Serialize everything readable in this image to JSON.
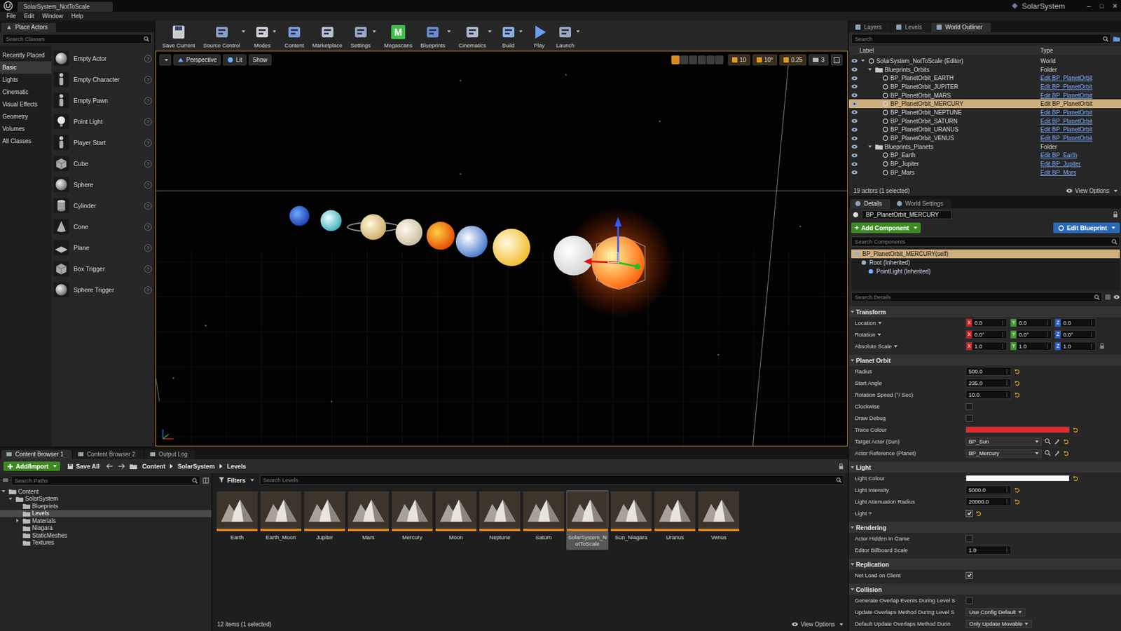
{
  "window": {
    "title": "SolarSystem_NotToScale",
    "project": "SolarSystem",
    "controls": [
      "–",
      "□",
      "✕"
    ]
  },
  "menu": [
    "File",
    "Edit",
    "Window",
    "Help"
  ],
  "place_actors": {
    "title": "Place Actors",
    "search_placeholder": "Search Classes",
    "help_glyph": "?",
    "categories": [
      {
        "label": "Recently Placed",
        "selected": false
      },
      {
        "label": "Basic",
        "selected": true
      },
      {
        "label": "Lights",
        "selected": false
      },
      {
        "label": "Cinematic",
        "selected": false
      },
      {
        "label": "Visual Effects",
        "selected": false
      },
      {
        "label": "Geometry",
        "selected": false
      },
      {
        "label": "Volumes",
        "selected": false
      },
      {
        "label": "All Classes",
        "selected": false
      }
    ],
    "items": [
      "Empty Actor",
      "Empty Character",
      "Empty Pawn",
      "Point Light",
      "Player Start",
      "Cube",
      "Sphere",
      "Cylinder",
      "Cone",
      "Plane",
      "Box Trigger",
      "Sphere Trigger"
    ]
  },
  "toolbar": [
    {
      "label": "Save Current",
      "dropdown": false
    },
    {
      "label": "Source Control",
      "dropdown": true
    },
    {
      "label": "Modes",
      "dropdown": true
    },
    {
      "label": "Content",
      "dropdown": false
    },
    {
      "label": "Marketplace",
      "dropdown": false
    },
    {
      "label": "Settings",
      "dropdown": true
    },
    {
      "label": "Megascans",
      "dropdown": false,
      "icon_text": "M"
    },
    {
      "label": "Blueprints",
      "dropdown": true
    },
    {
      "label": "Cinematics",
      "dropdown": true
    },
    {
      "label": "Build",
      "dropdown": true
    },
    {
      "label": "Play",
      "dropdown": false
    },
    {
      "label": "Launch",
      "dropdown": true
    }
  ],
  "viewport": {
    "view_mode": "Perspective",
    "lighting": "Lit",
    "show": "Show",
    "grid_snap": "10",
    "rotation_snap": "10°",
    "scale_snap": "0.25",
    "camera_speed": "3"
  },
  "content_browser": {
    "tabs": [
      {
        "label": "Content Browser 1",
        "selected": true
      },
      {
        "label": "Content Browser 2",
        "selected": false
      },
      {
        "label": "Output Log",
        "selected": false
      }
    ],
    "add_import": "Add/Import",
    "save_all": "Save All",
    "breadcrumb": [
      "Content",
      "SolarSystem",
      "Levels"
    ],
    "path_search": "Search Paths",
    "filters": "Filters",
    "search_placeholder": "Search Levels",
    "tree": [
      {
        "label": "Content",
        "depth": 0,
        "has_children": true,
        "expanded": true,
        "selected": false
      },
      {
        "label": "SolarSystem",
        "depth": 1,
        "has_children": true,
        "expanded": true,
        "selected": false
      },
      {
        "label": "Blueprints",
        "depth": 2,
        "has_children": false,
        "expanded": false,
        "selected": false
      },
      {
        "label": "Levels",
        "depth": 2,
        "has_children": false,
        "expanded": false,
        "selected": true
      },
      {
        "label": "Materials",
        "depth": 2,
        "has_children": true,
        "expanded": false,
        "selected": false
      },
      {
        "label": "Niagara",
        "depth": 2,
        "has_children": false,
        "expanded": false,
        "selected": false
      },
      {
        "label": "StaticMeshes",
        "depth": 2,
        "has_children": false,
        "expanded": false,
        "selected": false
      },
      {
        "label": "Textures",
        "depth": 2,
        "has_children": false,
        "expanded": false,
        "selected": false
      }
    ],
    "assets": [
      {
        "label": "Earth",
        "selected": false
      },
      {
        "label": "Earth_Moon",
        "selected": false
      },
      {
        "label": "Jupiter",
        "selected": false
      },
      {
        "label": "Mars",
        "selected": false
      },
      {
        "label": "Mercury",
        "selected": false
      },
      {
        "label": "Moon",
        "selected": false
      },
      {
        "label": "Neptune",
        "selected": false
      },
      {
        "label": "Saturn",
        "selected": false
      },
      {
        "label": "SolarSystem_NotToScale",
        "selected": true
      },
      {
        "label": "Sun_Niagara",
        "selected": false
      },
      {
        "label": "Uranus",
        "selected": false
      },
      {
        "label": "Venus",
        "selected": false
      }
    ],
    "status": "12 items (1 selected)",
    "view_options": "View Options"
  },
  "outliner": {
    "tabs": [
      {
        "label": "Layers",
        "selected": false
      },
      {
        "label": "Levels",
        "selected": false
      },
      {
        "label": "World Outliner",
        "selected": true
      }
    ],
    "search_placeholder": "Search",
    "columns": [
      "Label",
      "Type"
    ],
    "rows": [
      {
        "label": "SolarSystem_NotToScale (Editor)",
        "type": "World",
        "depth": 0,
        "kind": "world",
        "expanded": true,
        "selected": false
      },
      {
        "label": "Blueprints_Orbits",
        "type": "Folder",
        "depth": 1,
        "kind": "folder",
        "expanded": true,
        "selected": false
      },
      {
        "label": "BP_PlanetOrbit_EARTH",
        "type": "Edit BP_PlanetOrbit",
        "depth": 2,
        "kind": "actor",
        "expanded": false,
        "selected": false
      },
      {
        "label": "BP_PlanetOrbit_JUPITER",
        "type": "Edit BP_PlanetOrbit",
        "depth": 2,
        "kind": "actor",
        "expanded": false,
        "selected": false
      },
      {
        "label": "BP_PlanetOrbit_MARS",
        "type": "Edit BP_PlanetOrbit",
        "depth": 2,
        "kind": "actor",
        "expanded": false,
        "selected": false
      },
      {
        "label": "BP_PlanetOrbit_MERCURY",
        "type": "Edit BP_PlanetOrbit",
        "depth": 2,
        "kind": "actor",
        "expanded": false,
        "selected": true
      },
      {
        "label": "BP_PlanetOrbit_NEPTUNE",
        "type": "Edit BP_PlanetOrbit",
        "depth": 2,
        "kind": "actor",
        "expanded": false,
        "selected": false
      },
      {
        "label": "BP_PlanetOrbit_SATURN",
        "type": "Edit BP_PlanetOrbit",
        "depth": 2,
        "kind": "actor",
        "expanded": false,
        "selected": false
      },
      {
        "label": "BP_PlanetOrbit_URANUS",
        "type": "Edit BP_PlanetOrbit",
        "depth": 2,
        "kind": "actor",
        "expanded": false,
        "selected": false
      },
      {
        "label": "BP_PlanetOrbit_VENUS",
        "type": "Edit BP_PlanetOrbit",
        "depth": 2,
        "kind": "actor",
        "expanded": false,
        "selected": false
      },
      {
        "label": "Blueprints_Planets",
        "type": "Folder",
        "depth": 1,
        "kind": "folder",
        "expanded": true,
        "selected": false
      },
      {
        "label": "BP_Earth",
        "type": "Edit BP_Earth",
        "depth": 2,
        "kind": "actor",
        "expanded": false,
        "selected": false
      },
      {
        "label": "BP_Jupiter",
        "type": "Edit BP_Jupiter",
        "depth": 2,
        "kind": "actor",
        "expanded": false,
        "selected": false
      },
      {
        "label": "BP_Mars",
        "type": "Edit BP_Mars",
        "depth": 2,
        "kind": "actor",
        "expanded": false,
        "selected": false
      }
    ],
    "status": "19 actors (1 selected)",
    "view_options": "View Options"
  },
  "details": {
    "tabs": [
      {
        "label": "Details",
        "selected": true
      },
      {
        "label": "World Settings",
        "selected": false
      }
    ],
    "name": "BP_PlanetOrbit_MERCURY",
    "add_component": "Add Component",
    "add_glyph": "+",
    "edit_blueprint": "Edit Blueprint",
    "search_components": "Search Components",
    "components": [
      {
        "label": "BP_PlanetOrbit_MERCURY(self)",
        "depth": 0,
        "selected": true
      },
      {
        "label": "Root (Inherited)",
        "depth": 1,
        "selected": false
      },
      {
        "label": "PointLight (Inherited)",
        "depth": 2,
        "selected": false
      }
    ],
    "search_details": "Search Details",
    "axes": [
      "X",
      "Y",
      "Z"
    ],
    "sections": [
      {
        "title": "Transform",
        "expanded": true,
        "rows": [
          {
            "label": "Location",
            "kind": "vec3",
            "dropdown": true,
            "lock": false,
            "values": [
              "0.0",
              "0.0",
              "0.0"
            ],
            "modified": false
          },
          {
            "label": "Rotation",
            "kind": "vec3",
            "dropdown": true,
            "lock": false,
            "values": [
              "0.0°",
              "0.0°",
              "0.0°"
            ],
            "modified": false
          },
          {
            "label": "Absolute Scale",
            "kind": "vec3",
            "dropdown": true,
            "lock": true,
            "values": [
              "1.0",
              "1.0",
              "1.0"
            ],
            "modified": false
          }
        ]
      },
      {
        "title": "Planet Orbit",
        "expanded": true,
        "rows": [
          {
            "label": "Radius",
            "kind": "number",
            "value": "500.0",
            "modified": true
          },
          {
            "label": "Start Angle",
            "kind": "number",
            "value": "235.0",
            "modified": true
          },
          {
            "label": "Rotation Speed (°/ Sec)",
            "kind": "number",
            "value": "10.0",
            "modified": true
          },
          {
            "label": "Clockwise",
            "kind": "checkbox",
            "checked": false,
            "modified": false
          },
          {
            "label": "Draw Debug",
            "kind": "checkbox",
            "checked": false,
            "modified": false
          },
          {
            "label": "Trace Colour",
            "kind": "color",
            "color": "#e8272b",
            "modified": true
          },
          {
            "label": "Target Actor (Sun)",
            "kind": "picker",
            "value": "BP_Sun",
            "modified": true
          },
          {
            "label": "Actor Reference (Planet)",
            "kind": "picker",
            "value": "BP_Mercury",
            "modified": true
          }
        ]
      },
      {
        "title": "Light",
        "expanded": true,
        "rows": [
          {
            "label": "Light Colour",
            "kind": "color",
            "color": "#ffffff",
            "modified": true
          },
          {
            "label": "Light Intensity",
            "kind": "number",
            "value": "5000.0",
            "modified": true
          },
          {
            "label": "Light Attenuation Radius",
            "kind": "number",
            "value": "20000.0",
            "modified": true
          },
          {
            "label": "Light ?",
            "kind": "checkbox",
            "checked": true,
            "modified": true
          }
        ]
      },
      {
        "title": "Rendering",
        "expanded": true,
        "rows": [
          {
            "label": "Actor Hidden In Game",
            "kind": "checkbox",
            "checked": false,
            "modified": false
          },
          {
            "label": "Editor Billboard Scale",
            "kind": "number",
            "value": "1.0",
            "modified": false
          }
        ]
      },
      {
        "title": "Replication",
        "expanded": true,
        "rows": [
          {
            "label": "Net Load on Client",
            "kind": "checkbox",
            "checked": true,
            "modified": false
          }
        ]
      },
      {
        "title": "Collision",
        "expanded": true,
        "rows": [
          {
            "label": "Generate Overlap Events During Level S",
            "kind": "checkbox",
            "checked": false,
            "modified": false
          },
          {
            "label": "Update Overlaps Method During Level S",
            "kind": "combo",
            "value": "Use Config Default",
            "modified": false
          },
          {
            "label": "Default Update Overlaps Method Durin",
            "kind": "combo",
            "value": "Only Update Movable",
            "modified": false
          }
        ]
      }
    ]
  }
}
